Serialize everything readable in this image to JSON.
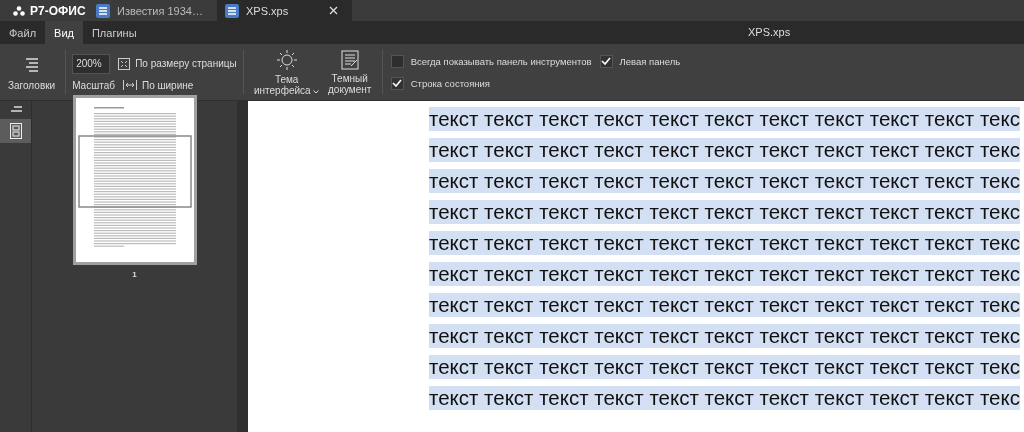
{
  "app": {
    "logo": "Р7-ОФИС"
  },
  "tabs": [
    {
      "label": "Известия 1934…",
      "selected": false,
      "closable": false
    },
    {
      "label": "XPS.xps",
      "selected": true,
      "closable": true
    }
  ],
  "menu": [
    {
      "label": "Файл",
      "selected": false
    },
    {
      "label": "Вид",
      "selected": true
    },
    {
      "label": "Плагины",
      "selected": false
    }
  ],
  "window": {
    "title": "XPS.xps"
  },
  "toolbar": {
    "headings": "Заголовки",
    "zoom_value": "200%",
    "zoom_label": "Масштаб",
    "fit_page": "По размеру страницы",
    "fit_width": "По ширине",
    "theme": "Тема интерфейса",
    "dark_document": "Темный документ",
    "checkboxes": [
      {
        "label": "Всегда показывать панель инструментов",
        "checked": false
      },
      {
        "label": "Левая панель",
        "checked": true
      },
      {
        "label": "Строка состояния",
        "checked": true
      }
    ]
  },
  "sidebar": {
    "items": [
      {
        "kind": "headings",
        "selected": false
      },
      {
        "kind": "thumbnails",
        "selected": true
      }
    ]
  },
  "thumbnails": [
    {
      "page": "1",
      "selected": true
    }
  ],
  "document": {
    "lines": [
      {
        "text": "текст текст текст текст текст текст текст текст текст текст текс",
        "selected": true
      },
      {
        "text": "текст текст текст текст текст текст текст текст текст текст текс",
        "selected": true
      },
      {
        "text": "текст текст текст текст текст текст текст текст текст текст текс",
        "selected": true
      },
      {
        "text": "текст текст текст текст текст текст текст текст текст текст текс",
        "selected": true
      },
      {
        "text": "текст текст текст текст текст текст текст текст текст текст текс",
        "selected": true
      },
      {
        "text": "текст текст текст текст текст текст текст текст текст текст текс",
        "selected": true
      },
      {
        "text": "текст текст текст текст текст текст текст текст текст текст текс",
        "selected": true
      },
      {
        "text": "текст текст текст текст текст текст текст текст текст текст текс",
        "selected": true
      },
      {
        "text": "текст текст текст текст текст текст текст текст текст текст текс",
        "selected": true
      },
      {
        "text": "текст текст текст текст текст текст текст текст текст текст текс",
        "selected": true
      }
    ]
  }
}
